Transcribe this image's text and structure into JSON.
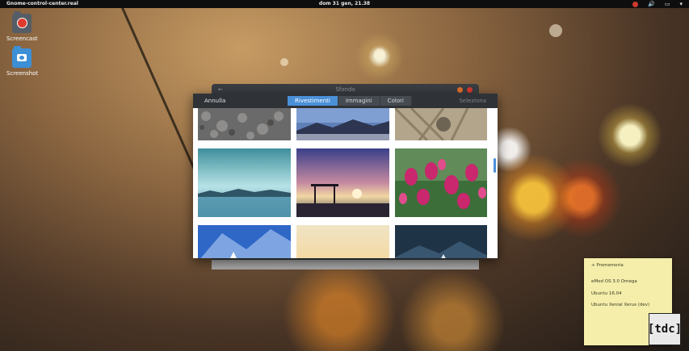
{
  "topbar": {
    "app_name": "Gnome-control-center.real",
    "clock": "dom 31 gen, 21.38",
    "tray": {
      "volume_icon": "🔊",
      "power_icon": "▭",
      "menu_icon": "▾"
    }
  },
  "desktop": {
    "icons": [
      {
        "label": "Screencast",
        "icon": "screencast-folder-icon"
      },
      {
        "label": "Screenshot",
        "icon": "screenshot-folder-icon"
      }
    ]
  },
  "background_window": {
    "title": "Sfondo",
    "back_symbol": "←"
  },
  "dialog": {
    "cancel_label": "Annulla",
    "select_label": "Seleziona",
    "tabs": [
      {
        "label": "Rivestimenti",
        "active": true
      },
      {
        "label": "Immagini",
        "active": false
      },
      {
        "label": "Colori",
        "active": false
      }
    ],
    "accent_color": "#4a90d9"
  },
  "sticky_note": {
    "add_label": "+ Promemoria",
    "lines": [
      "eMod OS 3.0 Omega",
      "Ubuntu 16.04",
      "Ubuntu Xenial Xerus (dev)"
    ],
    "background_color": "#f4eeaa"
  },
  "logo": {
    "text": "[tdc]"
  }
}
